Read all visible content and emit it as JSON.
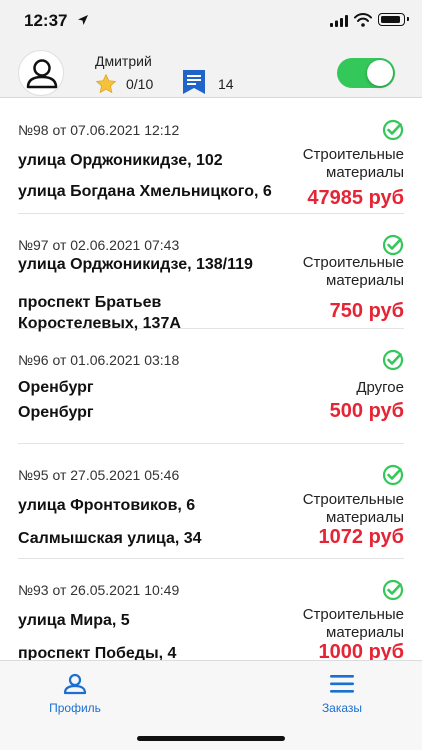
{
  "status_bar": {
    "time": "12:37"
  },
  "header": {
    "user_name": "Дмитрий",
    "rating": "0/10",
    "orders_count": "14",
    "online_toggle_on": true
  },
  "orders": [
    {
      "header": "№98 от 07.06.2021 12:12",
      "from": "улица Орджоникидзе, 102",
      "to": "улица Богдана Хмельницкого, 6",
      "category": "Строительные материалы",
      "price": "47985 руб"
    },
    {
      "header": "№97 от 02.06.2021 07:43",
      "from": "улица Орджоникидзе, 138/119",
      "to": "проспект Братьев Коростелевых, 137А",
      "category": "Строительные материалы",
      "price": "750 руб"
    },
    {
      "header": "№96 от 01.06.2021 03:18",
      "from": "Оренбург",
      "to": "Оренбург",
      "category": "Другое",
      "price": "500 руб"
    },
    {
      "header": "№95 от 27.05.2021 05:46",
      "from": "улица Фронтовиков, 6",
      "to": "Салмышская улица, 34",
      "category": "Строительные материалы",
      "price": "1072 руб"
    },
    {
      "header": "№93 от 26.05.2021 10:49",
      "from": "улица Мира, 5",
      "to": "проспект Победы, 4",
      "category": "Строительные материалы",
      "price": "1000 руб"
    }
  ],
  "tab_bar": {
    "profile_label": "Профиль",
    "orders_label": "Заказы"
  },
  "colors": {
    "accent": "#1a6fd0",
    "price": "#e52535",
    "toggle": "#34c759",
    "check": "#34c759"
  }
}
